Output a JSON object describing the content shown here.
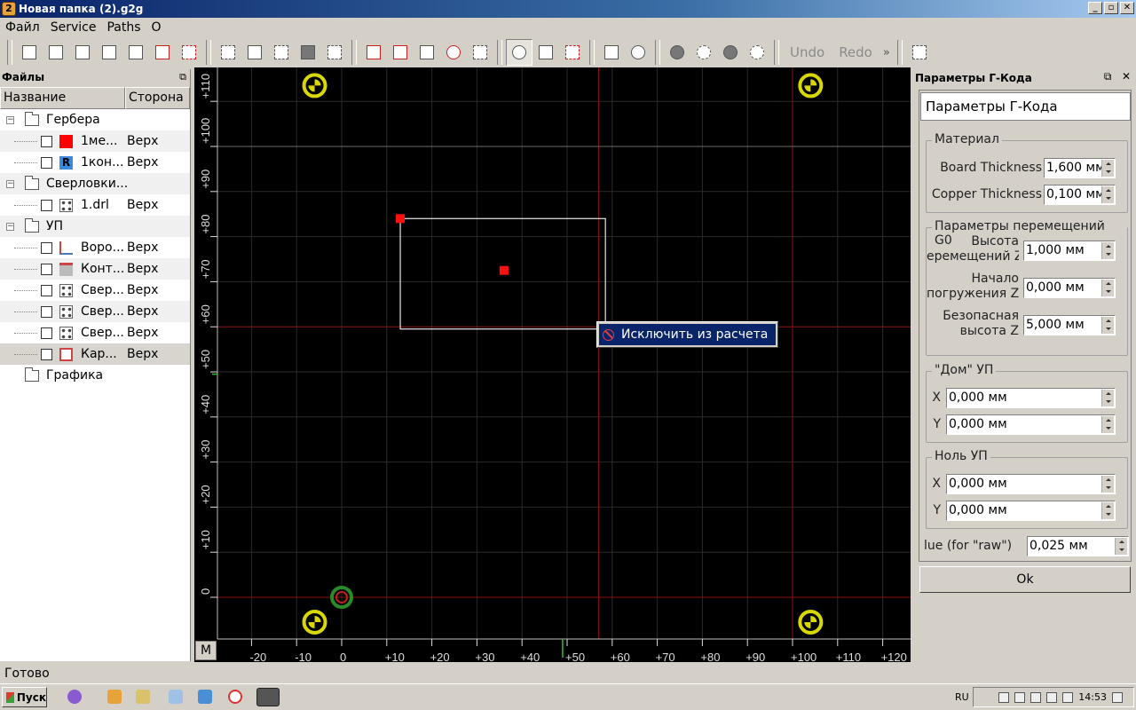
{
  "window": {
    "title": "Новая папка (2).g2g",
    "min_label": "_",
    "restore_label": "▫",
    "close_label": "✕"
  },
  "menu": [
    "Файл",
    "Service",
    "Paths",
    "O"
  ],
  "toolbar": {
    "undo_label": "Undo",
    "redo_label": "Redo",
    "more_label": "»"
  },
  "left_panel": {
    "title": "Файлы",
    "float_icon": "restore-icon",
    "columns": [
      "Название",
      "Сторона"
    ],
    "rows": [
      {
        "name": "Гербера",
        "side": "",
        "type": "folder",
        "level": 0
      },
      {
        "name": "1ме...",
        "side": "Верх",
        "type": "gerber-fill",
        "level": 1,
        "color": "#ff0000"
      },
      {
        "name": "1кон...",
        "side": "Верх",
        "type": "gerber-r",
        "level": 1,
        "color": "#3a8be0"
      },
      {
        "name": "Сверловки...",
        "side": "",
        "type": "folder",
        "level": 0
      },
      {
        "name": "1.drl",
        "side": "Верх",
        "type": "drill",
        "level": 1
      },
      {
        "name": "УП",
        "side": "",
        "type": "folder",
        "level": 0
      },
      {
        "name": "Воро...",
        "side": "Верх",
        "type": "path-voronoi",
        "level": 1
      },
      {
        "name": "Конт...",
        "side": "Верх",
        "type": "path-contour",
        "level": 1
      },
      {
        "name": "Свер...",
        "side": "Верх",
        "type": "drill",
        "level": 1
      },
      {
        "name": "Свер...",
        "side": "Верх",
        "type": "drill",
        "level": 1
      },
      {
        "name": "Свер...",
        "side": "Верх",
        "type": "drill",
        "level": 1
      },
      {
        "name": "Кар...",
        "side": "Верх",
        "type": "path-pocket",
        "level": 1,
        "selected": true
      },
      {
        "name": "Графика",
        "side": "",
        "type": "folder",
        "level": 0
      }
    ]
  },
  "canvas": {
    "background": "#000000",
    "x_ticks": [
      "-20",
      "-10",
      "0",
      "+10",
      "+20",
      "+30",
      "+40",
      "+50",
      "+60",
      "+70",
      "+80",
      "+90",
      "+100",
      "+110",
      "+120"
    ],
    "y_ticks": [
      "0",
      "+10",
      "+20",
      "+30",
      "+40",
      "+50",
      "+60",
      "+70",
      "+80",
      "+90",
      "+100",
      "+110"
    ],
    "mode_button": "M",
    "context_menu": {
      "item": "Исключить из расчета",
      "icon": "forbidden-icon"
    }
  },
  "right_panel": {
    "title": "Параметры Г-Кода",
    "header": "Параметры Г-Кода",
    "material": {
      "legend": "Материал",
      "board_thickness_label": "Board Thickness",
      "board_thickness": "1,600 мм",
      "copper_thickness_label": "Copper Thickness",
      "copper_thickness": "0,100 мм"
    },
    "g0": {
      "legend": "Параметры перемещений G0",
      "travel_z_label": "Высота\nеремещений Z",
      "travel_z": "1,000 мм",
      "plunge_z_label": "Начало\nпогружения Z",
      "plunge_z": "0,000 мм",
      "safe_z_label": "Безопасная\nвысота Z",
      "safe_z": "5,000 мм"
    },
    "home": {
      "legend": "\"Дом\" УП",
      "x_label": "X",
      "x": "0,000 мм",
      "y_label": "Y",
      "y": "0,000 мм"
    },
    "zero": {
      "legend": "Ноль УП",
      "x_label": "X",
      "x": "0,000 мм",
      "y_label": "Y",
      "y": "0,000 мм"
    },
    "raw_label": "lue (for \"raw\")",
    "raw_value": "0,025 мм",
    "ok_label": "Ok"
  },
  "statusbar": {
    "text": "Готово"
  },
  "taskbar": {
    "start_label": "Пуск",
    "lang": "RU",
    "time": "14:53"
  }
}
